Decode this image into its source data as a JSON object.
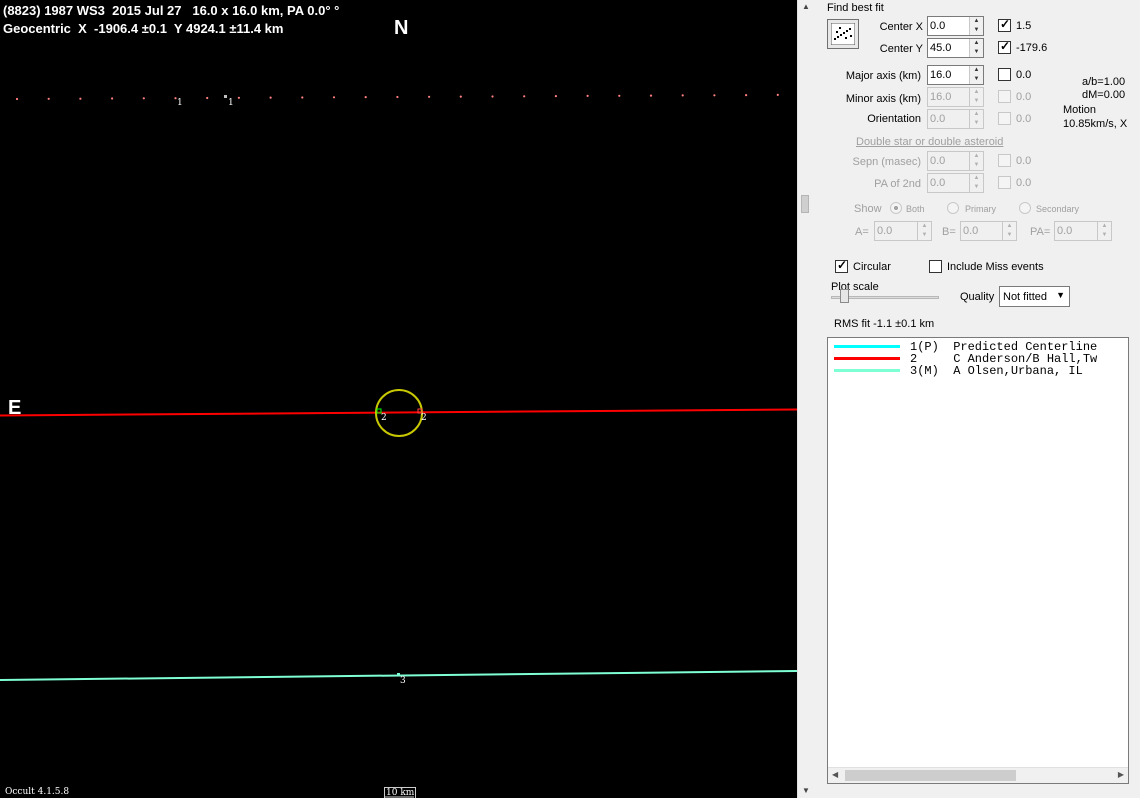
{
  "plot": {
    "header_line1": "(8823) 1987 WS3  2015 Jul 27   16.0 x 16.0 km, PA 0.0° °",
    "header_line2": "Geocentric  X  -1906.4 ±0.1  Y 4924.1 ±11.4 km",
    "north_label": "N",
    "east_label": "E",
    "point_label_1a": "1",
    "point_label_1b": "1",
    "point_label_2a": "2",
    "point_label_2b": "2",
    "point_label_3": "3",
    "version": "Occult 4.1.5.8",
    "scale_label": "10 km",
    "colors": {
      "track1": "#ff8080",
      "track2": "#ff0000",
      "track3": "#7fffd4",
      "ellipse": "#c8c800",
      "background": "#000000"
    }
  },
  "panel": {
    "find_best_fit_label": "Find best fit",
    "best_fit_icon": "scatter-plot-icon",
    "center_x_label": "Center X",
    "center_x_value": "0.0",
    "center_x_fit_checked": true,
    "center_x_fit_value": "1.5",
    "center_y_label": "Center Y",
    "center_y_value": "45.0",
    "center_y_fit_checked": true,
    "center_y_fit_value": "-179.6",
    "major_axis_label": "Major axis (km)",
    "major_axis_value": "16.0",
    "major_axis_fit_value": "0.0",
    "minor_axis_label": "Minor axis (km)",
    "minor_axis_value": "16.0",
    "minor_axis_fit_value": "0.0",
    "orientation_label": "Orientation",
    "orientation_value": "0.0",
    "orientation_fit_value": "0.0",
    "ab_ratio": "a/b=1.00",
    "dm": "dM=0.00",
    "motion_label": "Motion",
    "motion_value": "10.85km/s, X",
    "double_star_link": "Double star  or  double asteroid",
    "sepn_label": "Sepn (masec)",
    "sepn_value": "0.0",
    "sepn_fit_value": "0.0",
    "pa2nd_label": "PA of 2nd",
    "pa2nd_value": "0.0",
    "pa2nd_fit_value": "0.0",
    "show_label": "Show",
    "show_options": [
      "Both",
      "Primary",
      "Secondary"
    ],
    "a_label": "A=",
    "a_value": "0.0",
    "b_label": "B=",
    "b_value": "0.0",
    "pa_label": "PA=",
    "pa_value": "0.0",
    "circular_label": "Circular",
    "circular_checked": true,
    "include_miss_label": "Include Miss events",
    "include_miss_checked": false,
    "plot_scale_label": "Plot scale",
    "quality_label": "Quality",
    "quality_value": "Not fitted",
    "rms_fit": "RMS fit -1.1 ±0.1 km"
  },
  "observers": [
    {
      "text": "1(P)  Predicted Centerline",
      "color": "#00ffff"
    },
    {
      "text": "2     C Anderson/B Hall,Tw",
      "color": "#ff0000"
    },
    {
      "text": "3(M)  A Olsen,Urbana, IL",
      "color": "#7fffd4"
    }
  ]
}
